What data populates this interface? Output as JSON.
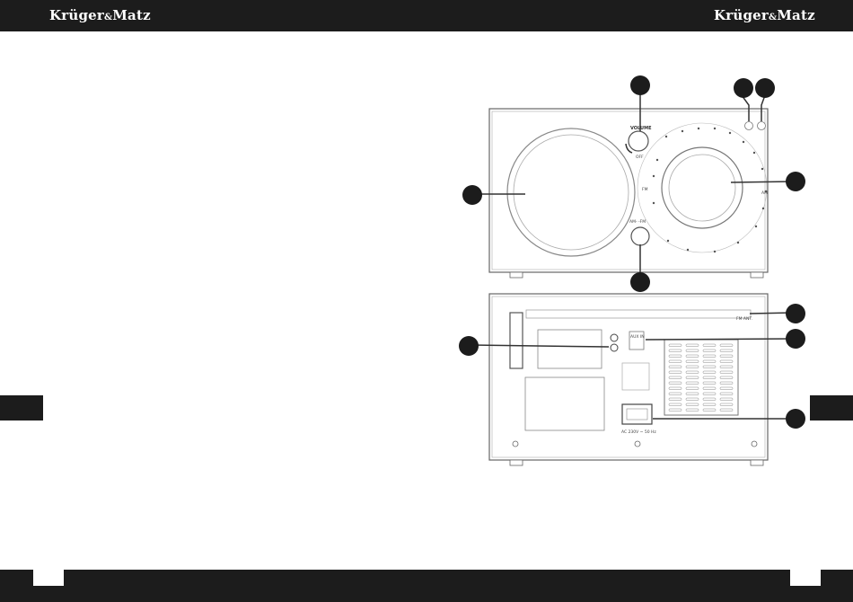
{
  "header": {
    "brand_left": "Krüger",
    "brand_left_amp": "&",
    "brand_left_end": "Matz",
    "brand_right": "Krüger",
    "brand_right_amp": "&",
    "brand_right_end": "Matz"
  },
  "front_panel": {
    "volume_label": "VOLUME",
    "off_label": "OFF",
    "band_label": "AM- -FM",
    "fm_label": "FM",
    "am_label": "AM"
  },
  "rear_panel": {
    "aux_label": "AUX IN",
    "power_label": "AC 230V ~ 50 Hz",
    "antenna_label": "FM ANT."
  },
  "colors": {
    "bar": "#1c1c1c",
    "callout": "#1c1c1c",
    "line": "#555555"
  }
}
